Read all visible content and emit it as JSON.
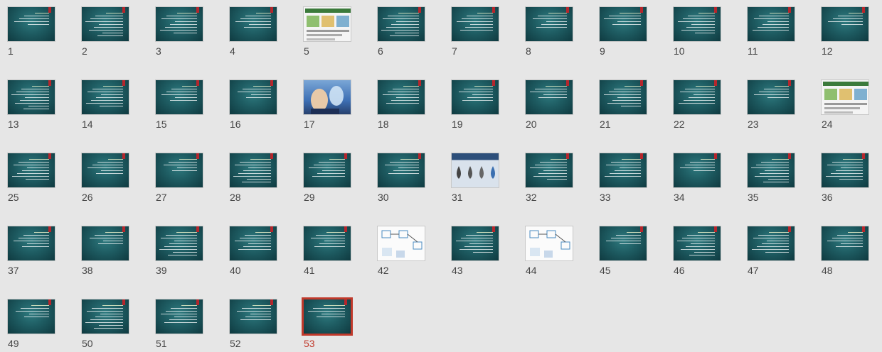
{
  "slides": [
    {
      "n": "1"
    },
    {
      "n": "2"
    },
    {
      "n": "3"
    },
    {
      "n": "4"
    },
    {
      "n": "5",
      "style": "light"
    },
    {
      "n": "6"
    },
    {
      "n": "7"
    },
    {
      "n": "8"
    },
    {
      "n": "9"
    },
    {
      "n": "10"
    },
    {
      "n": "11"
    },
    {
      "n": "12"
    },
    {
      "n": "13"
    },
    {
      "n": "14"
    },
    {
      "n": "15"
    },
    {
      "n": "16"
    },
    {
      "n": "17",
      "style": "photo"
    },
    {
      "n": "18"
    },
    {
      "n": "19"
    },
    {
      "n": "20"
    },
    {
      "n": "21"
    },
    {
      "n": "22"
    },
    {
      "n": "23"
    },
    {
      "n": "24",
      "style": "light"
    },
    {
      "n": "25"
    },
    {
      "n": "26"
    },
    {
      "n": "27"
    },
    {
      "n": "28"
    },
    {
      "n": "29"
    },
    {
      "n": "30"
    },
    {
      "n": "31",
      "style": "water"
    },
    {
      "n": "32"
    },
    {
      "n": "33"
    },
    {
      "n": "34"
    },
    {
      "n": "35"
    },
    {
      "n": "36"
    },
    {
      "n": "37"
    },
    {
      "n": "38"
    },
    {
      "n": "39"
    },
    {
      "n": "40"
    },
    {
      "n": "41"
    },
    {
      "n": "42",
      "style": "diagram"
    },
    {
      "n": "43"
    },
    {
      "n": "44",
      "style": "diagram"
    },
    {
      "n": "45"
    },
    {
      "n": "46"
    },
    {
      "n": "47"
    },
    {
      "n": "48"
    },
    {
      "n": "49"
    },
    {
      "n": "50"
    },
    {
      "n": "51"
    },
    {
      "n": "52"
    },
    {
      "n": "53",
      "selected": true
    }
  ],
  "colors": {
    "selected": "#c0392b",
    "slide_bg": "#1e5c62",
    "flag": "#b5262c"
  }
}
